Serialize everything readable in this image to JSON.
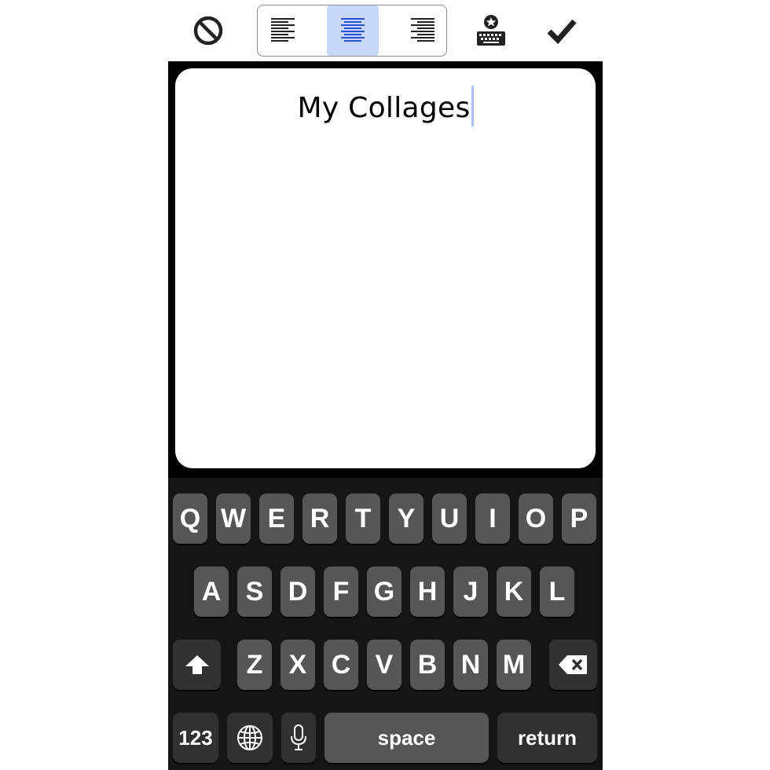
{
  "toolbar": {
    "cancel_icon": "prohibited-icon",
    "alignment_options": [
      "align-left",
      "align-center",
      "align-right"
    ],
    "selected_alignment": "align-center",
    "keyboard_toggle_icon": "keyboard-star-icon",
    "confirm_icon": "checkmark-icon",
    "accent_color": "#c7d8fb"
  },
  "editor": {
    "text": "My Collages"
  },
  "keyboard": {
    "row1": [
      "Q",
      "W",
      "E",
      "R",
      "T",
      "Y",
      "U",
      "I",
      "O",
      "P"
    ],
    "row2": [
      "A",
      "S",
      "D",
      "F",
      "G",
      "H",
      "J",
      "K",
      "L"
    ],
    "row3": [
      "Z",
      "X",
      "C",
      "V",
      "B",
      "N",
      "M"
    ],
    "numbers_label": "123",
    "space_label": "space",
    "return_label": "return",
    "shift_icon": "shift-arrow-icon",
    "delete_icon": "backspace-icon",
    "globe_icon": "globe-icon",
    "mic_icon": "microphone-icon"
  }
}
